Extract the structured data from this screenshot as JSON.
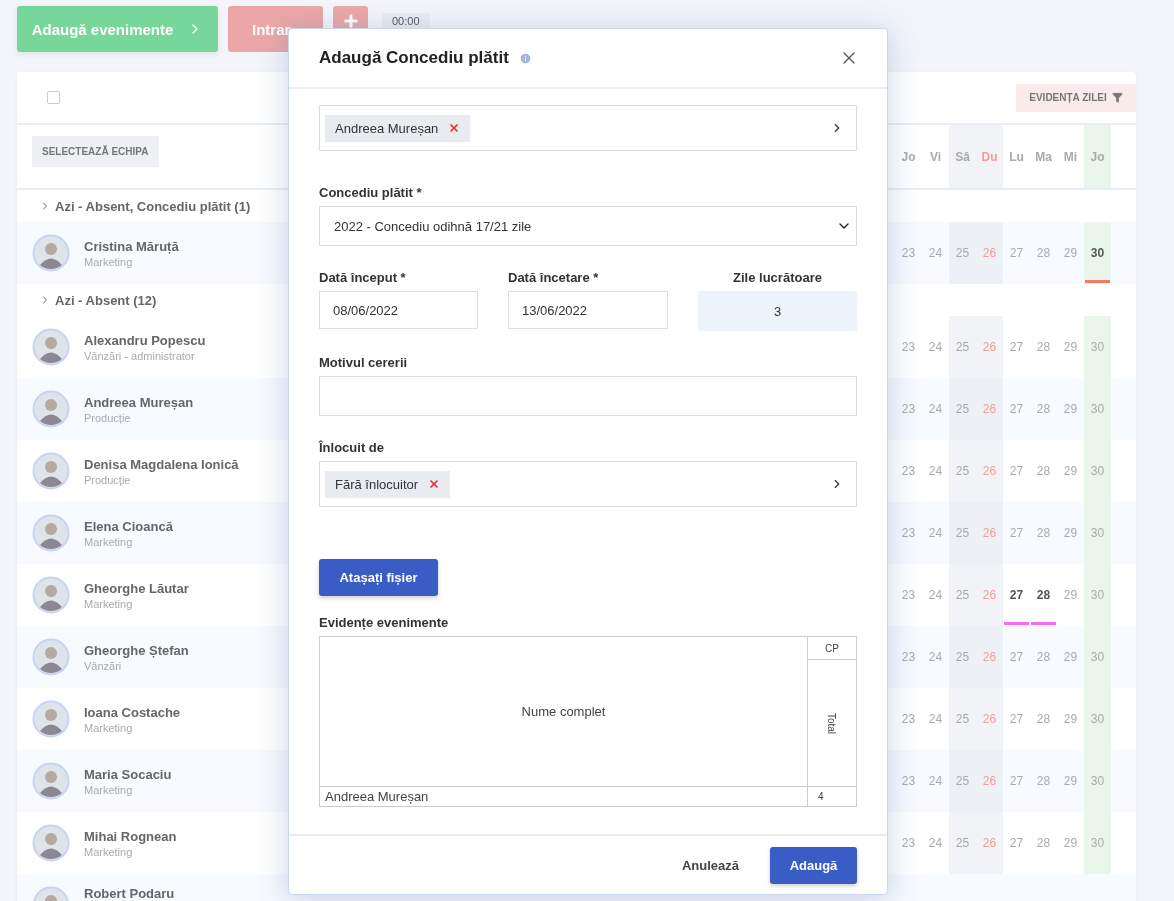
{
  "toolbar": {
    "add_events": "Adaugă evenimente",
    "check_in": "Intrar",
    "time": "00:00"
  },
  "card": {
    "select_all_checked": false,
    "day_filter": "EVIDENȚA ZILEI",
    "team_button": "SELECTEAZĂ ECHIPA",
    "day_columns": [
      {
        "label": "Jo",
        "kind": "weekday"
      },
      {
        "label": "Vi",
        "kind": "weekday"
      },
      {
        "label": "Sâ",
        "kind": "saturday"
      },
      {
        "label": "Du",
        "kind": "sunday"
      },
      {
        "label": "Lu",
        "kind": "weekday"
      },
      {
        "label": "Ma",
        "kind": "weekday"
      },
      {
        "label": "Mi",
        "kind": "weekday"
      },
      {
        "label": "Jo",
        "kind": "today"
      }
    ],
    "groups": [
      {
        "title": "Azi - Absent, Concediu plătit (1)",
        "people": [
          {
            "name": "Cristina Māruță",
            "team": "Marketing",
            "days": [
              {
                "n": "23",
                "bold": false
              },
              {
                "n": "24",
                "bold": false
              },
              {
                "n": "25",
                "bold": false
              },
              {
                "n": "26",
                "bold": false
              },
              {
                "n": "27",
                "bold": false
              },
              {
                "n": "28",
                "bold": false
              },
              {
                "n": "29",
                "bold": false
              },
              {
                "n": "30",
                "bold": true,
                "color": "#f07a68"
              }
            ]
          }
        ]
      },
      {
        "title": "Azi - Absent (12)",
        "people": [
          {
            "name": "Alexandru Popescu",
            "team": "Vânzări - administrator",
            "days": [
              {
                "n": "23",
                "bold": false
              },
              {
                "n": "24",
                "bold": false
              },
              {
                "n": "25",
                "bold": false
              },
              {
                "n": "26",
                "bold": false
              },
              {
                "n": "27",
                "bold": false
              },
              {
                "n": "28",
                "bold": false
              },
              {
                "n": "29",
                "bold": false
              },
              {
                "n": "30",
                "bold": false
              }
            ]
          },
          {
            "name": "Andreea Mureșan",
            "team": "Producție",
            "days": [
              {
                "n": "23",
                "bold": false
              },
              {
                "n": "24",
                "bold": false
              },
              {
                "n": "25",
                "bold": false
              },
              {
                "n": "26",
                "bold": false
              },
              {
                "n": "27",
                "bold": false
              },
              {
                "n": "28",
                "bold": false
              },
              {
                "n": "29",
                "bold": false
              },
              {
                "n": "30",
                "bold": false
              }
            ]
          },
          {
            "name": "Denisa Magdalena Ionică",
            "team": "Producție",
            "days": [
              {
                "n": "23",
                "bold": false
              },
              {
                "n": "24",
                "bold": false
              },
              {
                "n": "25",
                "bold": false
              },
              {
                "n": "26",
                "bold": false
              },
              {
                "n": "27",
                "bold": false
              },
              {
                "n": "28",
                "bold": false
              },
              {
                "n": "29",
                "bold": false
              },
              {
                "n": "30",
                "bold": false
              }
            ]
          },
          {
            "name": "Elena Cioancă",
            "team": "Marketing",
            "days": [
              {
                "n": "23",
                "bold": false
              },
              {
                "n": "24",
                "bold": false
              },
              {
                "n": "25",
                "bold": false
              },
              {
                "n": "26",
                "bold": false
              },
              {
                "n": "27",
                "bold": false
              },
              {
                "n": "28",
                "bold": false
              },
              {
                "n": "29",
                "bold": false
              },
              {
                "n": "30",
                "bold": false
              }
            ]
          },
          {
            "name": "Gheorghe Lăutar",
            "team": "Marketing",
            "days": [
              {
                "n": "23",
                "bold": false
              },
              {
                "n": "24",
                "bold": false
              },
              {
                "n": "25",
                "bold": false
              },
              {
                "n": "26",
                "bold": false
              },
              {
                "n": "27",
                "bold": true,
                "color": "#f76cf0"
              },
              {
                "n": "28",
                "bold": true,
                "color": "#f76cf0"
              },
              {
                "n": "29",
                "bold": false
              },
              {
                "n": "30",
                "bold": false
              }
            ]
          },
          {
            "name": "Gheorghe Ștefan",
            "team": "Vânzări",
            "days": [
              {
                "n": "23",
                "bold": false
              },
              {
                "n": "24",
                "bold": false
              },
              {
                "n": "25",
                "bold": false
              },
              {
                "n": "26",
                "bold": false
              },
              {
                "n": "27",
                "bold": false
              },
              {
                "n": "28",
                "bold": false
              },
              {
                "n": "29",
                "bold": false
              },
              {
                "n": "30",
                "bold": false
              }
            ]
          },
          {
            "name": "Ioana Costache",
            "team": "Marketing",
            "days": [
              {
                "n": "23",
                "bold": false
              },
              {
                "n": "24",
                "bold": false
              },
              {
                "n": "25",
                "bold": false
              },
              {
                "n": "26",
                "bold": false
              },
              {
                "n": "27",
                "bold": false
              },
              {
                "n": "28",
                "bold": false
              },
              {
                "n": "29",
                "bold": false
              },
              {
                "n": "30",
                "bold": false
              }
            ]
          },
          {
            "name": "Maria Socaciu",
            "team": "Marketing",
            "days": [
              {
                "n": "23",
                "bold": false
              },
              {
                "n": "24",
                "bold": false
              },
              {
                "n": "25",
                "bold": false
              },
              {
                "n": "26",
                "bold": false
              },
              {
                "n": "27",
                "bold": false
              },
              {
                "n": "28",
                "bold": false
              },
              {
                "n": "29",
                "bold": false
              },
              {
                "n": "30",
                "bold": false
              }
            ]
          },
          {
            "name": "Mihai Rognean",
            "team": "Marketing",
            "days": [
              {
                "n": "23",
                "bold": false
              },
              {
                "n": "24",
                "bold": false
              },
              {
                "n": "25",
                "bold": false
              },
              {
                "n": "26",
                "bold": false
              },
              {
                "n": "27",
                "bold": false
              },
              {
                "n": "28",
                "bold": false
              },
              {
                "n": "29",
                "bold": false
              },
              {
                "n": "30",
                "bold": false
              }
            ]
          },
          {
            "name": "Robert Podaru"
          }
        ]
      }
    ]
  },
  "modal": {
    "title": "Adaugă Concediu plătit",
    "employee_tags": [
      {
        "label": "Andreea Mureșan"
      }
    ],
    "leave_type": {
      "label": "Concediu plătit *",
      "value": "2022 - Concediu odihnă 17/21 zile"
    },
    "start": {
      "label": "Dată început *",
      "value": "08/06/2022"
    },
    "end": {
      "label": "Dată încetare *",
      "value": "13/06/2022"
    },
    "working_days": {
      "label": "Zile lucrătoare",
      "value": "3"
    },
    "reason": {
      "label": "Motivul cererii"
    },
    "replacement": {
      "label": "Înlocuit de",
      "tags": [
        {
          "label": "Fără înlocuitor"
        }
      ]
    },
    "attach_button": "Atașați fișier",
    "events_table": {
      "title": "Evidențe evenimente",
      "name_header": "Nume complet",
      "group_header": "CP",
      "total_header": "Total",
      "rows": [
        {
          "name": "Andreea Mureșan",
          "total": "4"
        }
      ]
    },
    "cancel": "Anulează",
    "submit": "Adaugă"
  }
}
